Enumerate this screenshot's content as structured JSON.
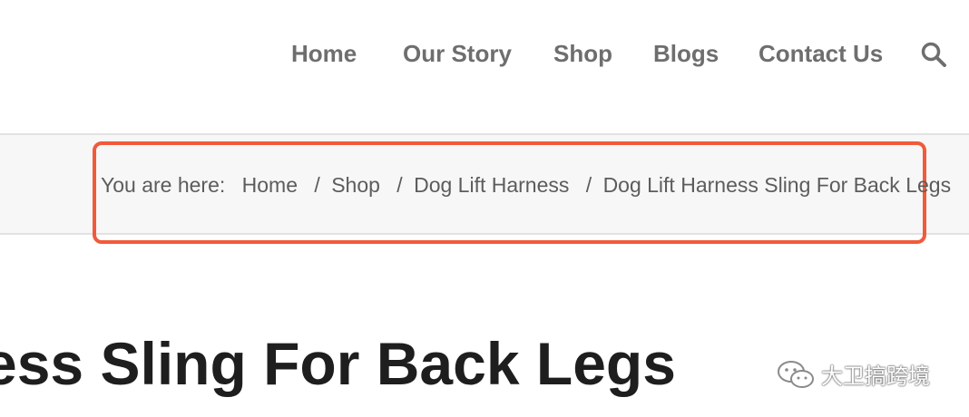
{
  "nav": {
    "items": [
      {
        "label": "Home"
      },
      {
        "label": "Our Story"
      },
      {
        "label": "Shop"
      },
      {
        "label": "Blogs"
      },
      {
        "label": "Contact Us"
      }
    ],
    "search_icon": "search-icon"
  },
  "breadcrumb": {
    "prefix": "You are here:",
    "separator": "/",
    "items": [
      {
        "label": "Home"
      },
      {
        "label": "Shop"
      },
      {
        "label": "Dog Lift Harness"
      },
      {
        "label": "Dog Lift Harness Sling For Back Legs"
      }
    ]
  },
  "page": {
    "title_visible": "ess Sling For Back Legs"
  },
  "watermark": {
    "text": "大卫搞跨境",
    "icon": "wechat-icon"
  },
  "colors": {
    "highlight_border": "#f15a3a",
    "nav_text": "#6e6e6e",
    "breadcrumb_bg": "#f7f7f7",
    "title_text": "#1e1e1e"
  }
}
